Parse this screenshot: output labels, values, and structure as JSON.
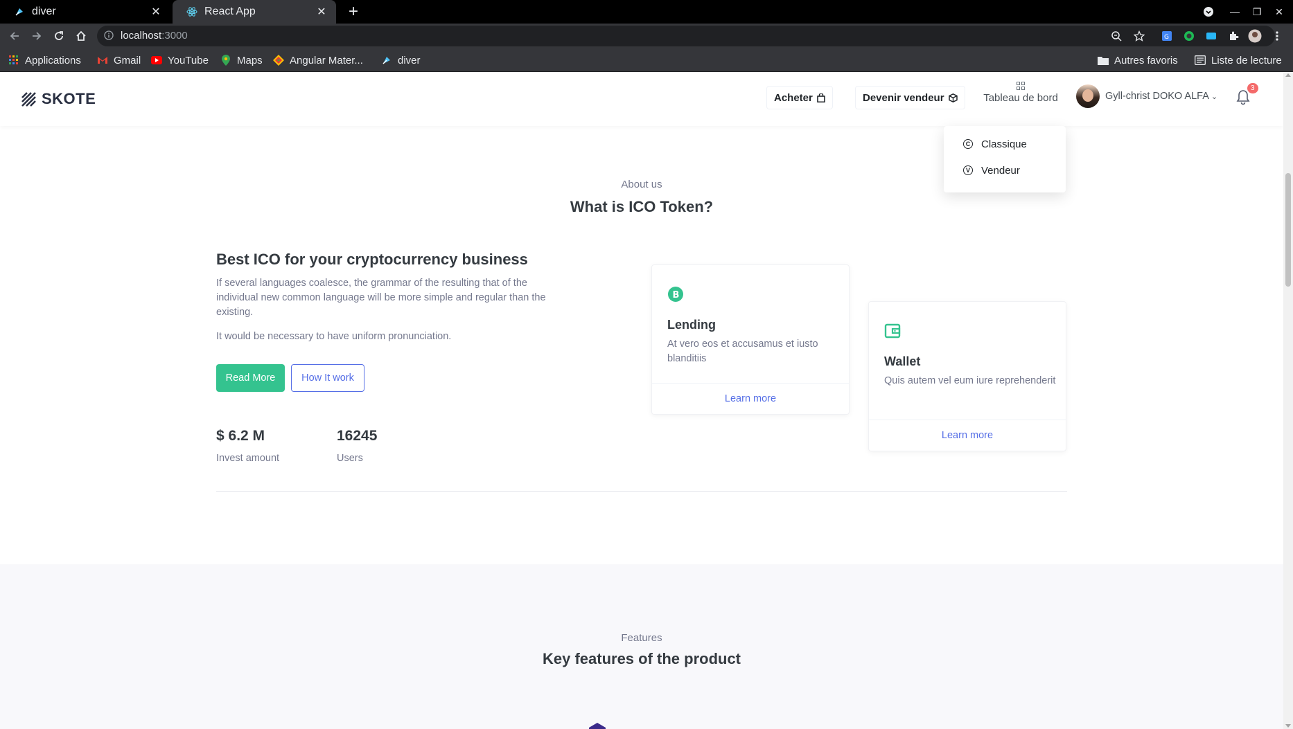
{
  "browser": {
    "tabs": [
      {
        "title": "diver",
        "active": false
      },
      {
        "title": "React App",
        "active": true
      }
    ],
    "address": {
      "host": "localhost",
      "port": ":3000"
    },
    "bookmarks": [
      {
        "label": "Applications",
        "icon": "apps-grid-icon"
      },
      {
        "label": "Gmail",
        "icon": "gmail-icon"
      },
      {
        "label": "YouTube",
        "icon": "youtube-icon"
      },
      {
        "label": "Maps",
        "icon": "maps-icon"
      },
      {
        "label": "Angular Mater...",
        "icon": "angular-material-icon"
      },
      {
        "label": "diver",
        "icon": "diver-icon"
      }
    ],
    "other_bookmarks": "Autres favoris",
    "reading_list": "Liste de lecture"
  },
  "header": {
    "brand": "SKOTE",
    "buy_label": "Acheter",
    "become_seller_label": "Devenir vendeur",
    "dashboard_label": "Tableau de bord",
    "user_name": "Gyll-christ DOKO ALFA",
    "notification_count": "3"
  },
  "dropdown": {
    "items": [
      {
        "label": "Classique",
        "icon_letter": "C"
      },
      {
        "label": "Vendeur",
        "icon_letter": "V"
      }
    ]
  },
  "about": {
    "subtitle": "About us",
    "title": "What is ICO Token?",
    "lead_title": "Best ICO for your cryptocurrency business",
    "paragraph1": "If several languages coalesce, the grammar of the resulting that of the individual new common language will be more simple and regular than the existing.",
    "paragraph2": "It would be necessary to have uniform pronunciation.",
    "read_more": "Read More",
    "how_it_work": "How It work",
    "stats": [
      {
        "value": "$ 6.2 M",
        "label": "Invest amount"
      },
      {
        "value": "16245",
        "label": "Users"
      }
    ],
    "cards": [
      {
        "title": "Lending",
        "text": "At vero eos et accusamus et iusto blanditiis",
        "link": "Learn more"
      },
      {
        "title": "Wallet",
        "text": "Quis autem vel eum iure reprehenderit",
        "link": "Learn more"
      }
    ]
  },
  "features": {
    "subtitle": "Features",
    "title": "Key features of the product"
  },
  "colors": {
    "primary": "#556ee6",
    "success": "#34c38f",
    "danger": "#f46a6a",
    "heading": "#343a40",
    "muted": "#74788d"
  }
}
